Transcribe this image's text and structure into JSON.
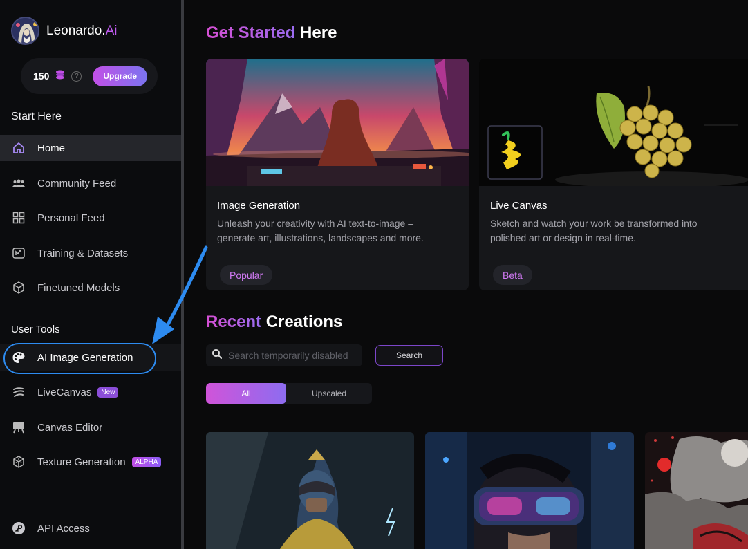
{
  "app": {
    "name_prefix": "Leonardo.",
    "name_suffix": "Ai"
  },
  "credits": {
    "count": "150",
    "upgrade_label": "Upgrade"
  },
  "sidebar": {
    "start_heading": "Start Here",
    "start_items": [
      {
        "label": "Home",
        "icon": "home-icon",
        "active": true
      },
      {
        "label": "Community Feed",
        "icon": "community-icon"
      },
      {
        "label": "Personal Feed",
        "icon": "grid-icon"
      },
      {
        "label": "Training & Datasets",
        "icon": "training-icon"
      },
      {
        "label": "Finetuned Models",
        "icon": "cube-icon"
      }
    ],
    "tools_heading": "User Tools",
    "tool_items": [
      {
        "label": "AI Image Generation",
        "icon": "palette-icon"
      },
      {
        "label": "LiveCanvas",
        "icon": "livecanvas-icon",
        "badge": "New"
      },
      {
        "label": "Canvas Editor",
        "icon": "easel-icon"
      },
      {
        "label": "Texture Generation",
        "icon": "texture-cube-icon",
        "badge": "ALPHA"
      }
    ],
    "api_item": {
      "label": "API Access",
      "icon": "key-icon"
    }
  },
  "main": {
    "get_started": {
      "highlight": "Get Started",
      "rest": " Here"
    },
    "cards": [
      {
        "title": "Image Generation",
        "description": "Unleash your creativity with AI text-to-image – generate art, illustrations, landscapes and more.",
        "tag": "Popular"
      },
      {
        "title": "Live Canvas",
        "description": "Sketch and watch your work be transformed into polished art or design in real-time.",
        "tag": "Beta"
      }
    ],
    "recent": {
      "highlight": "Recent",
      "rest": " Creations"
    },
    "search": {
      "placeholder": "Search temporarily disabled",
      "button_label": "Search"
    },
    "filter_options": [
      "All",
      "Upscaled"
    ],
    "filter_selected": "All"
  },
  "colors": {
    "accent_purple": "#c25cf2",
    "annotation_blue": "#2d8bf0"
  }
}
